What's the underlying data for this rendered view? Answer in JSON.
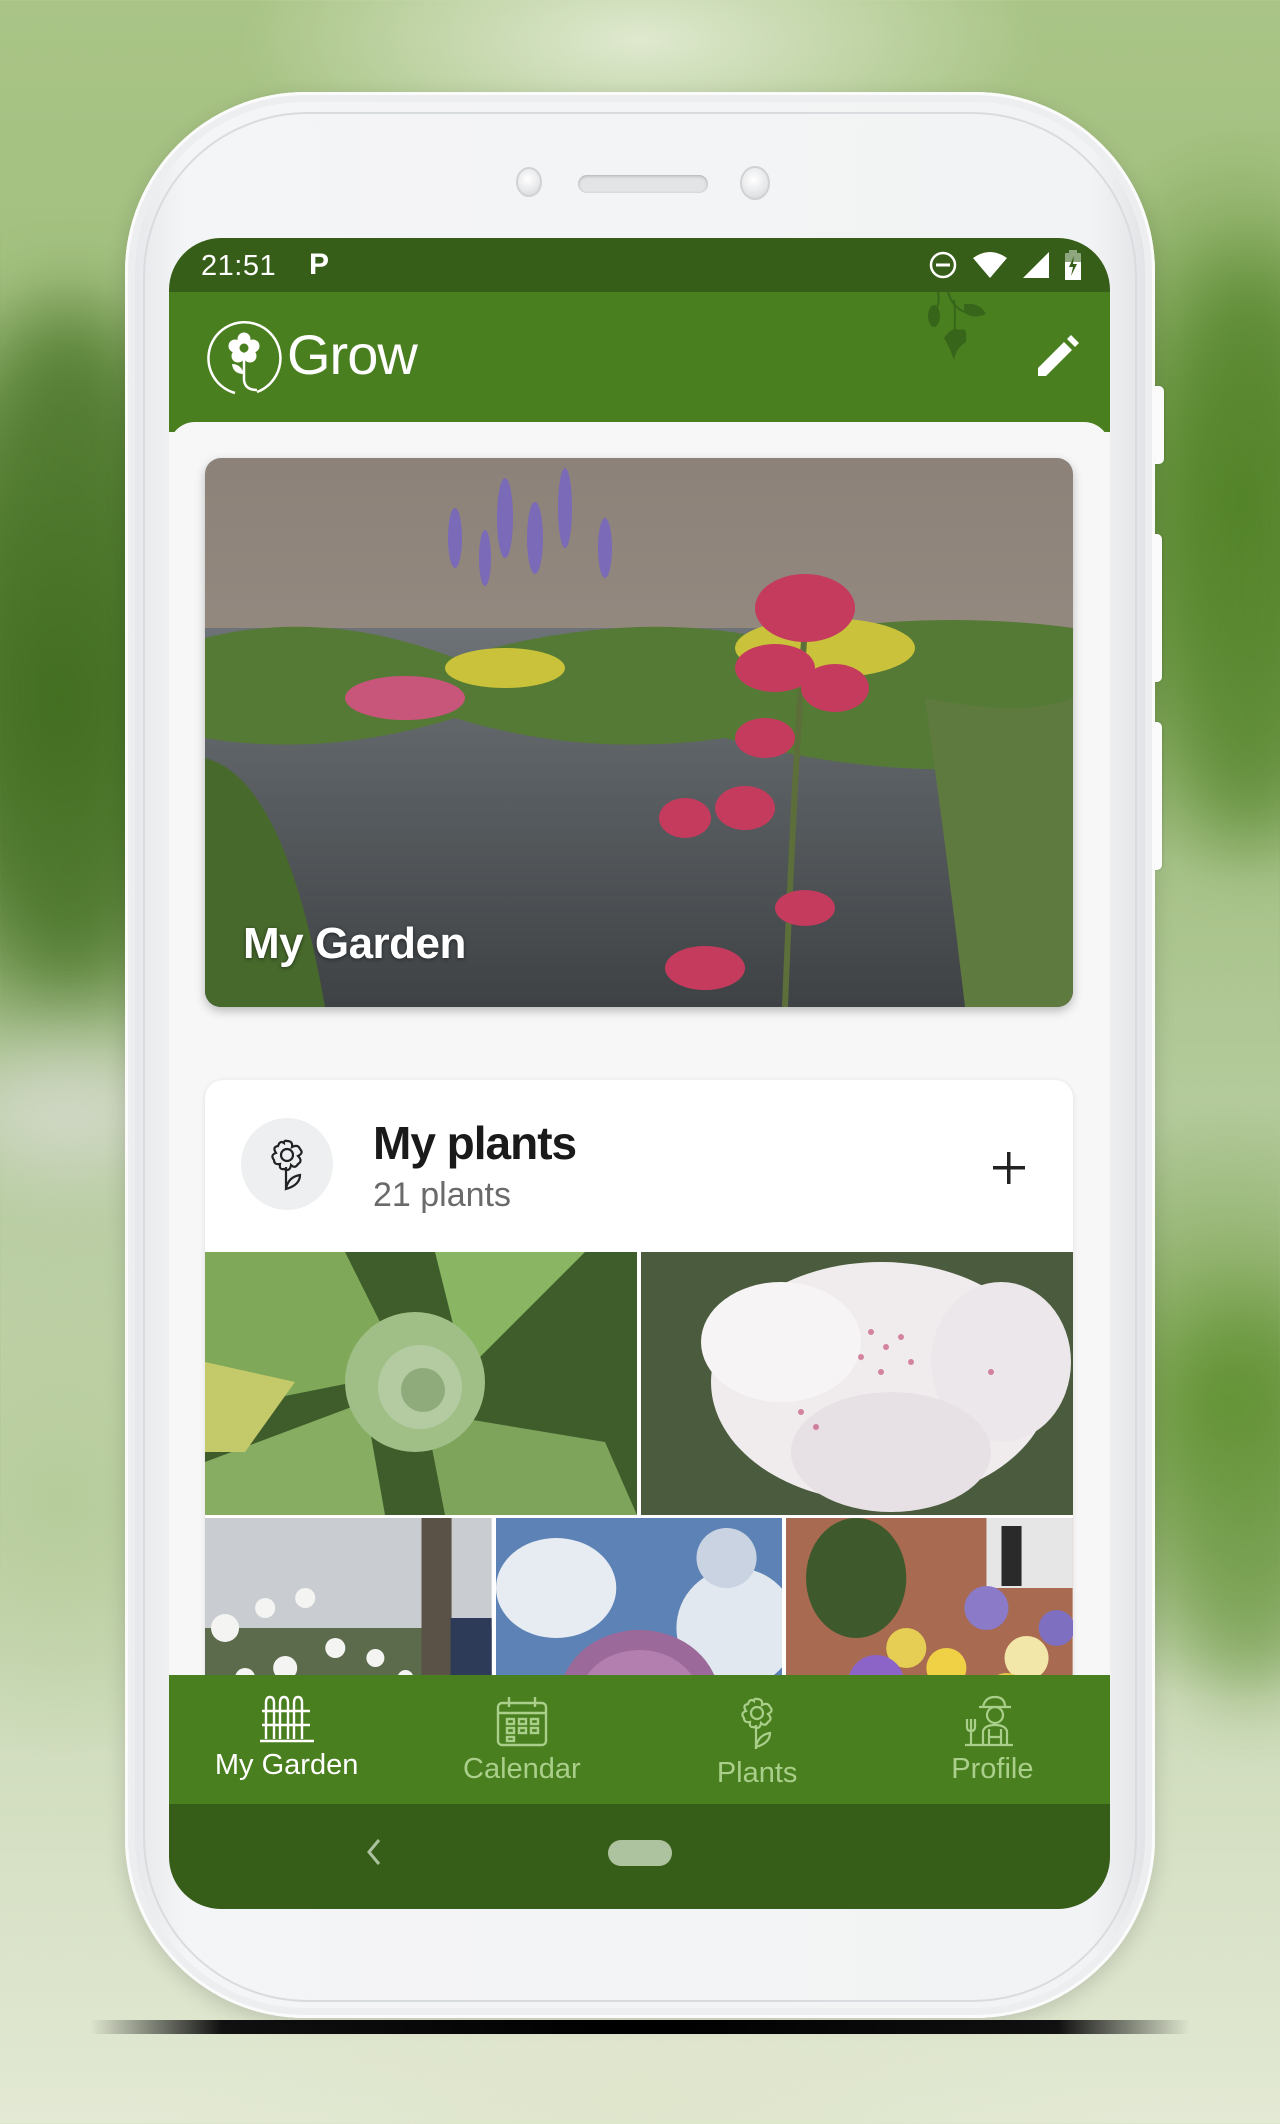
{
  "status_bar": {
    "time": "21:51",
    "notification_icon": "parking-p-icon",
    "icons": [
      "do-not-disturb-icon",
      "wifi-icon",
      "cell-signal-icon",
      "battery-charging-icon"
    ]
  },
  "app_bar": {
    "title": "Grow",
    "logo_icon": "flower-circle-logo-icon",
    "edit_icon": "pencil-icon"
  },
  "hero": {
    "title": "My Garden"
  },
  "plants_card": {
    "title": "My plants",
    "count": "21 plants",
    "icon": "flower-icon",
    "add_icon": "plus-icon",
    "photos": [
      {
        "subject": "woolly mullein rosette"
      },
      {
        "subject": "white rhododendron"
      },
      {
        "subject": "daisies"
      },
      {
        "subject": "allium"
      },
      {
        "subject": "pansies"
      }
    ]
  },
  "bottom_nav": {
    "items": [
      {
        "label": "My Garden",
        "icon": "fence-icon",
        "active": true
      },
      {
        "label": "Calendar",
        "icon": "calendar-icon",
        "active": false
      },
      {
        "label": "Plants",
        "icon": "flower-icon",
        "active": false
      },
      {
        "label": "Profile",
        "icon": "gardener-icon",
        "active": false
      }
    ]
  },
  "colors": {
    "status_bar": "#365e18",
    "app_bar": "#4a7f1f",
    "nav_active": "#ffffff",
    "nav_inactive": "#a9cf8a",
    "content_bg": "#f7f7f7"
  }
}
